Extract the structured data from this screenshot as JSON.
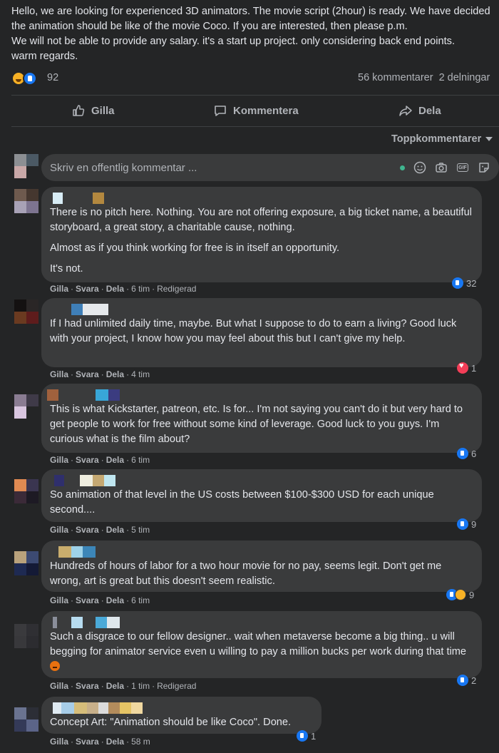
{
  "post": {
    "text": "Hello, we are looking for experienced 3D animators. The movie script (2hour) is ready. We have decided the animation should be like of the movie Coco. If you are interested, then please p.m.\nWe will not be able to provide any salary. it's a start up project. only considering back end points.\nwarm regards.",
    "reaction_count": "92",
    "comments_count": "56 kommentarer",
    "shares_count": "2 delningar"
  },
  "actions": {
    "like": "Gilla",
    "comment": "Kommentera",
    "share": "Dela"
  },
  "sort_label": "Toppkommentarer",
  "composer": {
    "placeholder": "Skriv en offentlig kommentar ..."
  },
  "meta_labels": {
    "like": "Gilla",
    "reply": "Svara",
    "share": "Dela"
  },
  "comments": [
    {
      "paragraphs": [
        "There is no pitch here. Nothing. You are not offering exposure, a big ticket name, a beautiful storyboard, a great story, a charitable cause, nothing.",
        "Almost as if you think working for free is in itself an opportunity.",
        "It's not."
      ],
      "time": "6 tim",
      "edited": "Redigerad",
      "reactions": "32"
    },
    {
      "paragraphs": [
        "If I had unlimited daily time, maybe. But what I suppose to do to earn a living? Good luck with your project, I know how you may feel about this but I can't give my help."
      ],
      "time": "4 tim",
      "reactions": "1"
    },
    {
      "paragraphs": [
        "This is what Kickstarter, patreon, etc. Is for... I'm not saying you can't do it but very hard to get people to work for free without some kind of leverage. Good luck to you guys. I'm curious what is the film about?"
      ],
      "time": "6 tim",
      "reactions": "6"
    },
    {
      "paragraphs": [
        "So animation of that level in the US costs between $100-$300 USD for each unique second...."
      ],
      "time": "5 tim",
      "reactions": "9"
    },
    {
      "paragraphs": [
        "Hundreds of hours of labor for a two hour movie for no pay, seems legit. Don't get me wrong, art is great but this doesn't seem realistic."
      ],
      "time": "6 tim",
      "reactions": "9"
    },
    {
      "paragraphs": [
        "Such a disgrace to our fellow designer.. wait when metaverse become a big thing.. u will begging for animator service even u willing to pay a million bucks per work during that time"
      ],
      "time": "1 tim",
      "edited": "Redigerad",
      "reactions": "2"
    },
    {
      "paragraphs": [
        "Concept Art: \"Animation should be like Coco\". Done."
      ],
      "time": "58 m",
      "reactions": "1"
    }
  ],
  "colors": {
    "background": "#242526",
    "bubble": "#3a3b3c",
    "text": "#e4e6eb",
    "secondary": "#b0b3b8",
    "like_blue": "#1877f2",
    "love_red": "#f33e58"
  },
  "icons": [
    "thumbs-up-icon",
    "comment-icon",
    "share-arrow-icon",
    "chevron-down-icon",
    "emoji-icon",
    "camera-icon",
    "gif-icon",
    "sticker-icon",
    "like-reaction-icon",
    "haha-reaction-icon",
    "love-reaction-icon",
    "care-reaction-icon",
    "angry-emoji-icon"
  ]
}
